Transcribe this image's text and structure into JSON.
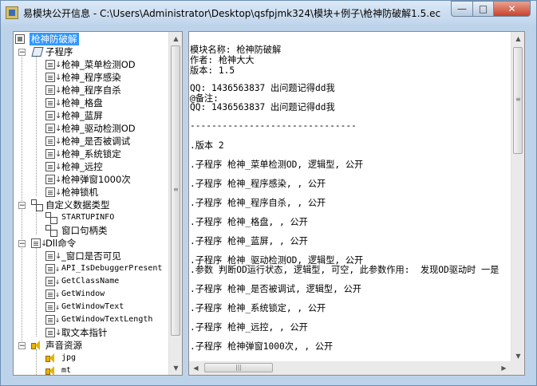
{
  "window": {
    "title": "易模块公开信息 - C:\\Users\\Administrator\\Desktop\\qsfpjmk324\\模块+例子\\枪神防破解1.5.ec",
    "min_glyph": "—",
    "max_glyph": "□",
    "close_glyph": "✕"
  },
  "tree": {
    "root": "枪神防破解",
    "subprograms": {
      "label": "子程序",
      "items": [
        "枪神_菜单检测OD",
        "枪神_程序感染",
        "枪神_程序自杀",
        "枪神_格盘",
        "枪神_蓝屏",
        "枪神_驱动检测OD",
        "枪神_是否被调试",
        "枪神_系统锁定",
        "枪神_远控",
        "枪神弹窗1000次",
        "枪神锁机"
      ]
    },
    "datatypes": {
      "label": "自定义数据类型",
      "items": [
        "STARTUPINFO",
        "窗口句柄类"
      ]
    },
    "dll": {
      "label": "Dll命令",
      "items": [
        "_窗口是否可见",
        "API_IsDebuggerPresent",
        "GetClassName",
        "GetWindow",
        "GetWindowText",
        "GetWindowTextLength",
        "取文本指针"
      ]
    },
    "sounds": {
      "label": "声音资源",
      "items": [
        "jpg",
        "mt"
      ]
    }
  },
  "document": {
    "lines": [
      "模块名称: 枪神防破解",
      "作者: 枪神大大",
      "版本: 1.5",
      "QQ: 1436563837 出问题记得dd我",
      "@备注:",
      "QQ: 1436563837 出问题记得dd我",
      "-------------------------------",
      ".版本 2",
      ".子程序 枪神_菜单检测OD, 逻辑型, 公开",
      ".子程序 枪神_程序感染, , 公开",
      ".子程序 枪神_程序自杀, , 公开",
      ".子程序 枪神_格盘, , 公开",
      ".子程序 枪神_蓝屏, , 公开",
      ".子程序 枪神_驱动检测OD, 逻辑型, 公开",
      ".参数 判断OD运行状态, 逻辑型, 可空, 此参数作用:  发现OD驱动时 一是",
      ".子程序 枪神_是否被调试, 逻辑型, 公开",
      ".子程序 枪神_系统锁定, , 公开",
      ".子程序 枪神_远控, , 公开",
      ".子程序 枪神弹窗1000次, , 公开"
    ]
  }
}
